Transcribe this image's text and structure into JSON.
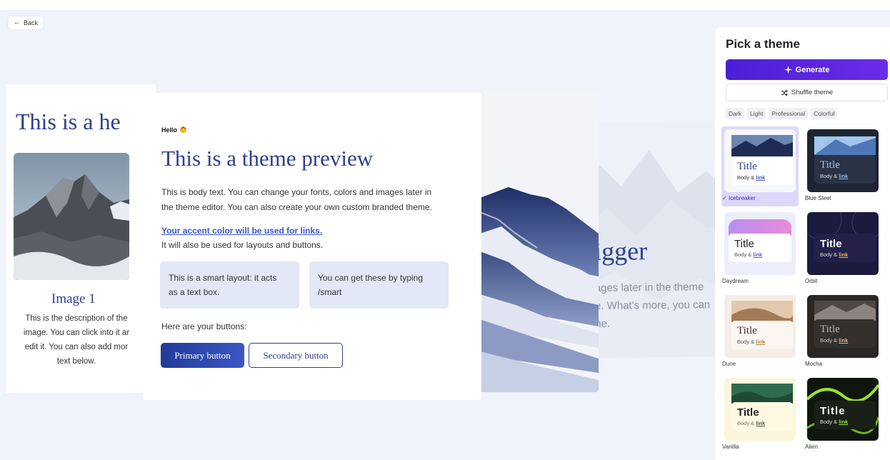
{
  "back": {
    "label": "Back"
  },
  "left_card": {
    "heading": "This is a he",
    "image_title": "Image 1",
    "desc_lines": [
      "This is the description of the",
      "image. You can click into it ar",
      "edit it. You can also add mor",
      "text below."
    ]
  },
  "main_card": {
    "hello": "Hello",
    "title": "This is a theme preview",
    "body_line1": "This is body text. You can change your fonts, colors and images later in",
    "body_line2": "the theme editor. You can also create your own custom branded theme.",
    "link": "Your accent color will be used for links.",
    "link_sub": "It will also be used for layouts and buttons.",
    "smart1_line1": "This is a smart layout: it acts",
    "smart1_line2": "as a text box.",
    "smart2_line1": "You can get these by typing",
    "smart2_line2": "/smart",
    "buttons_label": "Here are your buttons:",
    "primary_button": "Primary button",
    "secondary_button": "Secondary button"
  },
  "back_card": {
    "heading": "igger",
    "line1": "ages later in the theme",
    "line2": "e. What's more, you can",
    "line3": "ne."
  },
  "panel": {
    "title": "Pick a theme",
    "generate": "Generate",
    "shuffle": "Shuffle theme",
    "filters": [
      "Dark",
      "Light",
      "Professional",
      "Colorful"
    ],
    "themes": [
      {
        "name": "Icebreaker",
        "selected": true
      },
      {
        "name": "Blue Steel"
      },
      {
        "name": "Daydream"
      },
      {
        "name": "Orbit"
      },
      {
        "name": "Dune"
      },
      {
        "name": "Mocha"
      },
      {
        "name": "Vanilla"
      },
      {
        "name": "Alien"
      }
    ],
    "thumb_title": "Title",
    "thumb_body": "Body &",
    "thumb_link": "link",
    "check": "✓"
  }
}
